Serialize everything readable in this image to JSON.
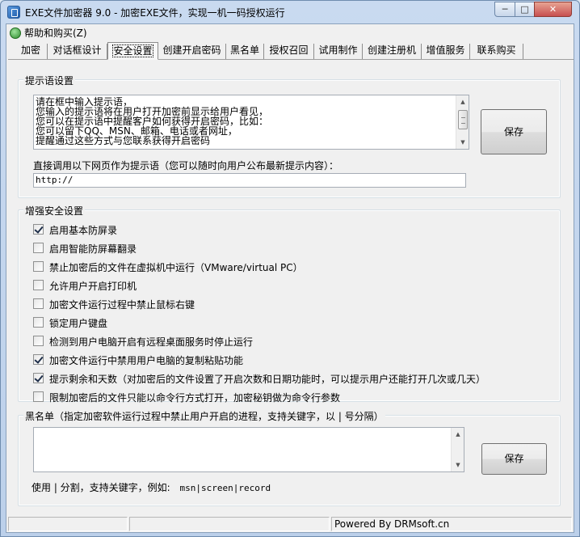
{
  "window": {
    "title": "EXE文件加密器 9.0 - 加密EXE文件，实现一机一码授权运行",
    "minimize_glyph": "─",
    "maximize_glyph": "□",
    "close_glyph": "✕"
  },
  "menu": {
    "help_label": "帮助和购买(Z)",
    "help_icon": "green-globe-icon"
  },
  "tabs": [
    {
      "label": "加密",
      "active": false
    },
    {
      "label": "对话框设计",
      "active": false
    },
    {
      "label": "安全设置",
      "active": true
    },
    {
      "label": "创建开启密码",
      "active": false
    },
    {
      "label": "黑名单",
      "active": false
    },
    {
      "label": "授权召回",
      "active": false
    },
    {
      "label": "试用制作",
      "active": false
    },
    {
      "label": "创建注册机",
      "active": false
    },
    {
      "label": "增值服务",
      "active": false
    },
    {
      "label": "联系购买",
      "active": false
    }
  ],
  "prompt_group": {
    "title": "提示语设置",
    "text_lines": [
      "请在框中输入提示语，",
      "您输入的提示语将在用户打开加密前显示给用户看见，",
      "您可以在提示语中提醒客户如何获得开启密码，比如：",
      "您可以留下QQ、MSN、邮箱、电话或者网址，",
      "提醒通过这些方式与您联系获得开启密码"
    ],
    "save_label": "保存",
    "url_label": "直接调用以下网页作为提示语（您可以随时向用户公布最新提示内容）：",
    "url_value": "http://"
  },
  "security_group": {
    "title": "增强安全设置",
    "options": [
      {
        "label": "启用基本防屏录",
        "checked": true
      },
      {
        "label": "启用智能防屏幕翻录",
        "checked": false
      },
      {
        "label": "禁止加密后的文件在虚拟机中运行（VMware/virtual PC）",
        "checked": false
      },
      {
        "label": "允许用户开启打印机",
        "checked": false
      },
      {
        "label": "加密文件运行过程中禁止鼠标右键",
        "checked": false
      },
      {
        "label": "锁定用户键盘",
        "checked": false
      },
      {
        "label": "检测到用户电脑开启有远程桌面服务时停止运行",
        "checked": false
      },
      {
        "label": "加密文件运行中禁用用户电脑的复制粘贴功能",
        "checked": true
      },
      {
        "label": "提示剩余和天数（对加密后的文件设置了开启次数和日期功能时，可以提示用户还能打开几次或几天）",
        "checked": true
      },
      {
        "label": "限制加密后的文件只能以命令行方式打开，加密秘钥做为命令行参数",
        "checked": false
      }
    ]
  },
  "blacklist_group": {
    "title": "黑名单（指定加密软件运行过程中禁止用户开启的进程，支持关键字，以 | 号分隔）",
    "text": "",
    "save_label": "保存",
    "hint_prefix": "使用 | 分割，支持关键字，例如:",
    "hint_example": "msn|screen|record"
  },
  "statusbar": {
    "pane1": "",
    "pane2": "",
    "powered_by": "Powered By DRMsoft.cn"
  }
}
